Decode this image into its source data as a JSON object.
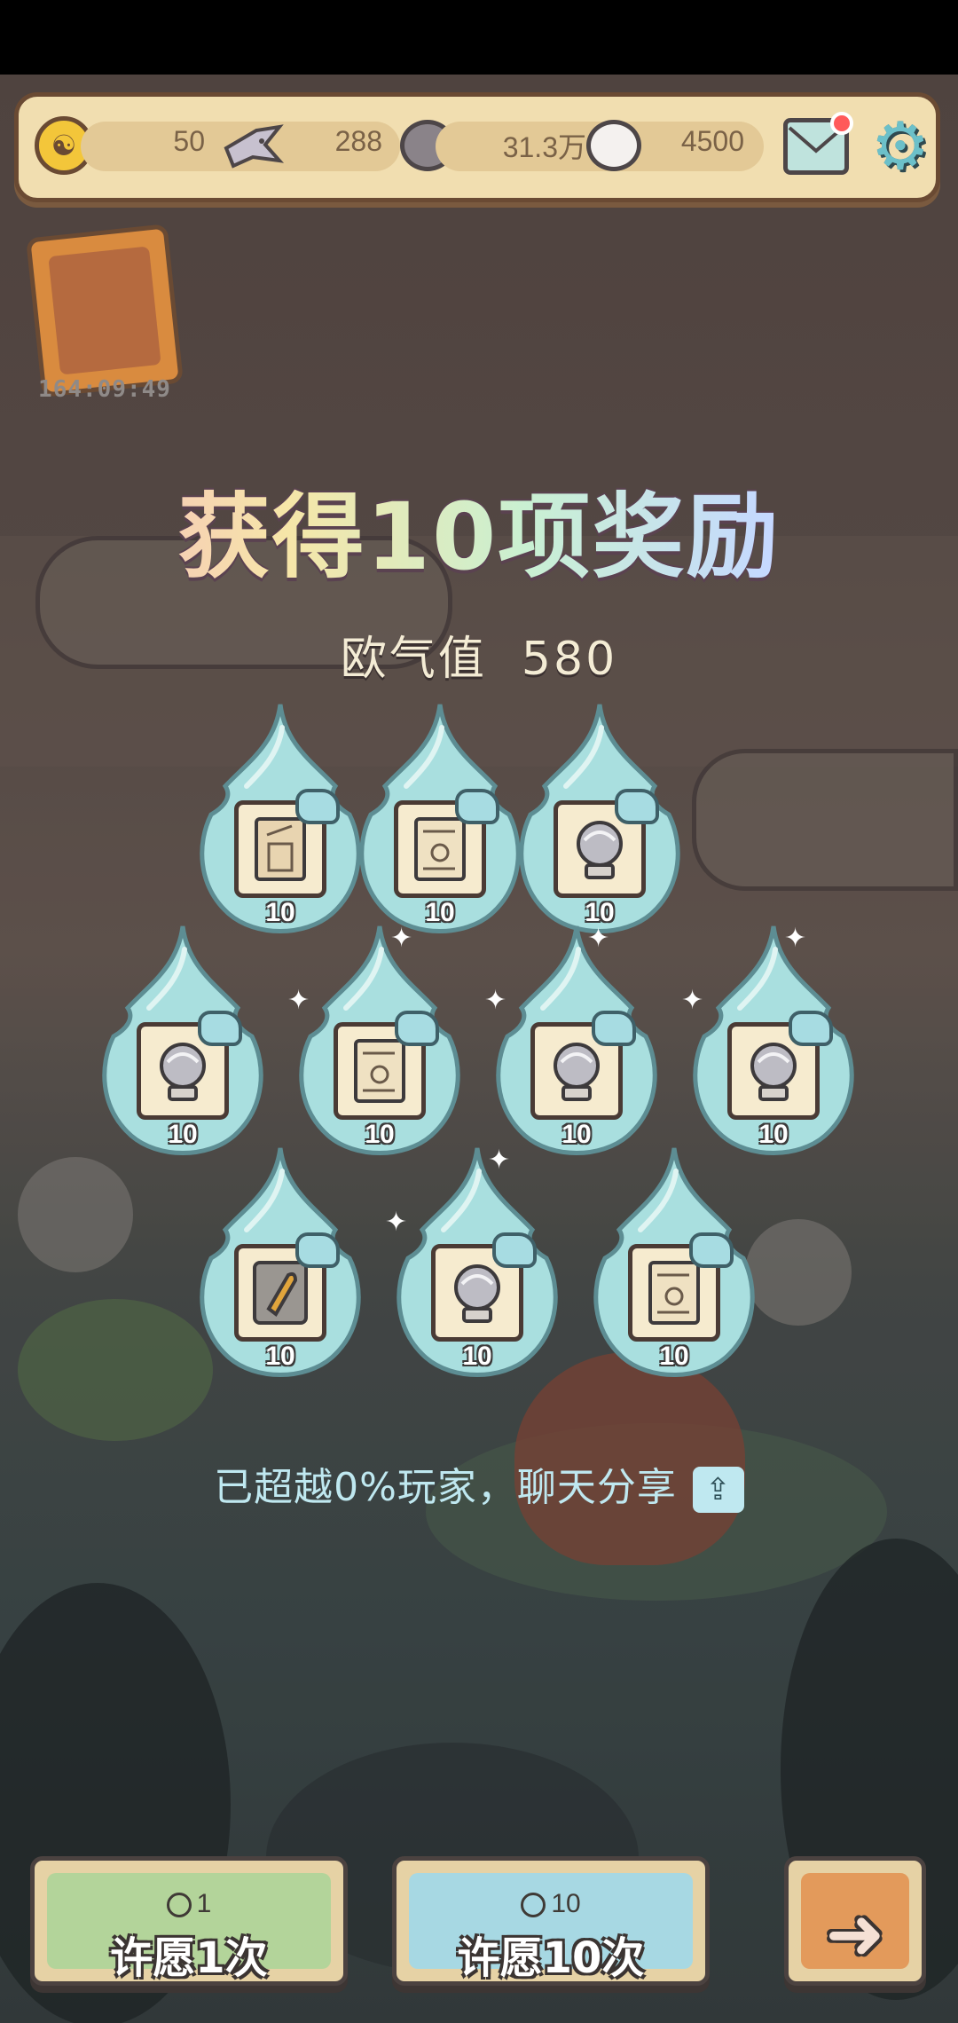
{
  "topbar": {
    "coins": "50",
    "shells": "288",
    "dark_orbs": "31.3万",
    "light_orbs": "4500",
    "icons": [
      "gold-coin-icon",
      "swallow-icon",
      "dark-orb-icon",
      "light-orb-icon",
      "mail-icon",
      "gear-icon"
    ]
  },
  "event": {
    "timer": "164:09:49"
  },
  "result": {
    "title": "获得10项奖励",
    "luck_label": "欧气值",
    "luck_value": "580"
  },
  "rewards": [
    {
      "count": "10",
      "icon": "scroll-tower-icon"
    },
    {
      "count": "10",
      "icon": "letter-document-icon"
    },
    {
      "count": "10",
      "icon": "crystal-ball-icon"
    },
    {
      "count": "10",
      "icon": "crystal-ball-icon"
    },
    {
      "count": "10",
      "icon": "letter-document-icon"
    },
    {
      "count": "10",
      "icon": "crystal-ball-icon"
    },
    {
      "count": "10",
      "icon": "crystal-ball-icon"
    },
    {
      "count": "10",
      "icon": "bullet-icon"
    },
    {
      "count": "10",
      "icon": "crystal-ball-icon"
    },
    {
      "count": "10",
      "icon": "letter-document-icon"
    }
  ],
  "share": {
    "text": "已超越0%玩家，聊天分享",
    "icon": "share-icon"
  },
  "buttons": {
    "wish_one": {
      "cost": "1",
      "label": "许愿1次"
    },
    "wish_ten": {
      "cost": "10",
      "label": "许愿10次"
    },
    "next": {
      "icon": "arrow-right-icon"
    }
  },
  "colors": {
    "flame": "#a9dfdf",
    "flame_border": "#5d8d93",
    "panel": "#f1deb0",
    "btn_green": "#b3d49a",
    "btn_blue": "#a7d8e3",
    "btn_orange": "#e39a5b"
  }
}
